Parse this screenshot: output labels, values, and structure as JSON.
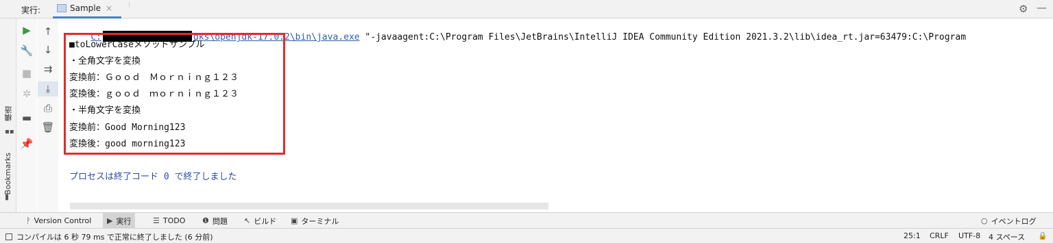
{
  "run_header": {
    "label": "実行:",
    "tab_name": "Sample",
    "tab_close": "×",
    "more": "⁝"
  },
  "left_strip": {
    "structure_label": "構造",
    "bookmarks_label": "Bookmarks"
  },
  "console": {
    "command": {
      "path_start": "C:",
      "path_end": "dks\\openjdk-17.0.2\\bin\\java.exe",
      "args": " \"-javaagent:C:\\Program Files\\JetBrains\\IntelliJ IDEA Community Edition 2021.3.2\\lib\\idea_rt.jar=63479:C:\\Program"
    },
    "lines": [
      "■toLowerCaseメソッドサンプル",
      "・全角文字を変換",
      "変換前：Ｇｏｏｄ　Ｍｏｒｎｉｎｇ１２３",
      "変換後：ｇｏｏｄ　ｍｏｒｎｉｎｇ１２３",
      "・半角文字を変換",
      "変換前：Good Morning123",
      "変換後：good morning123"
    ],
    "exit_message": "プロセスは終了コード 0 で終了しました"
  },
  "tool_windows": [
    {
      "icon": "version-control-icon",
      "label": "Version Control"
    },
    {
      "icon": "run-icon",
      "label": "実行"
    },
    {
      "icon": "todo-icon",
      "label": "TODO"
    },
    {
      "icon": "problems-icon",
      "label": "問題"
    },
    {
      "icon": "build-icon",
      "label": "ビルド"
    },
    {
      "icon": "terminal-icon",
      "label": "ターミナル"
    }
  ],
  "event_log": "イベントログ",
  "status_bar": {
    "message": "コンパイルは 6 秒 79 ms で正常に終了しました (6 分前)",
    "position": "25:1",
    "line_sep": "CRLF",
    "encoding": "UTF-8",
    "indent": "4 スペース"
  },
  "colors": {
    "link": "#2c5fb0",
    "highlight_box": "#e52a2a",
    "exit_text": "#2c4aa8",
    "active_tab_underline": "#4083c9"
  }
}
